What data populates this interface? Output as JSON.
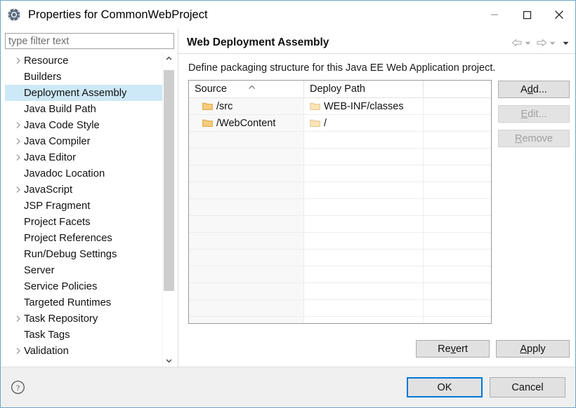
{
  "window": {
    "title": "Properties for CommonWebProject",
    "app_icon": "gear-icon",
    "minimize_label": "Minimize",
    "maximize_label": "Maximize",
    "close_label": "Close"
  },
  "filter": {
    "placeholder": "type filter text",
    "value": ""
  },
  "tree": {
    "selected": "Deployment Assembly",
    "items": [
      {
        "label": "Resource",
        "expandable": true
      },
      {
        "label": "Builders",
        "expandable": false
      },
      {
        "label": "Deployment Assembly",
        "expandable": false
      },
      {
        "label": "Java Build Path",
        "expandable": false
      },
      {
        "label": "Java Code Style",
        "expandable": true
      },
      {
        "label": "Java Compiler",
        "expandable": true
      },
      {
        "label": "Java Editor",
        "expandable": true
      },
      {
        "label": "Javadoc Location",
        "expandable": false
      },
      {
        "label": "JavaScript",
        "expandable": true
      },
      {
        "label": "JSP Fragment",
        "expandable": false
      },
      {
        "label": "Project Facets",
        "expandable": false
      },
      {
        "label": "Project References",
        "expandable": false
      },
      {
        "label": "Run/Debug Settings",
        "expandable": false
      },
      {
        "label": "Server",
        "expandable": false
      },
      {
        "label": "Service Policies",
        "expandable": false
      },
      {
        "label": "Targeted Runtimes",
        "expandable": false
      },
      {
        "label": "Task Repository",
        "expandable": true
      },
      {
        "label": "Task Tags",
        "expandable": false
      },
      {
        "label": "Validation",
        "expandable": true
      }
    ]
  },
  "page": {
    "title": "Web Deployment Assembly",
    "description": "Define packaging structure for this Java EE Web Application project.",
    "nav": {
      "back_icon": "back-arrow-icon",
      "back_menu_icon": "chevron-down-icon",
      "forward_icon": "forward-arrow-icon",
      "forward_menu_icon": "chevron-down-icon",
      "menu_icon": "chevron-down-icon"
    }
  },
  "table": {
    "sort_column": "Source",
    "sort_direction": "ascending",
    "columns": [
      "Source",
      "Deploy Path",
      ""
    ],
    "rows": [
      {
        "source": "/src",
        "deploy_path": "WEB-INF/classes",
        "icon": "folder-icon"
      },
      {
        "source": "/WebContent",
        "deploy_path": "/",
        "icon": "folder-icon"
      }
    ],
    "empty_row_count": 12
  },
  "side_buttons": [
    {
      "label": "Add...",
      "mnemonic": "d",
      "enabled": true
    },
    {
      "label": "Edit...",
      "mnemonic": "E",
      "enabled": false
    },
    {
      "label": "Remove",
      "mnemonic": "R",
      "enabled": false
    }
  ],
  "apply_buttons": [
    {
      "label": "Revert",
      "mnemonic": "v",
      "enabled": true
    },
    {
      "label": "Apply",
      "mnemonic": "A",
      "enabled": true
    }
  ],
  "footer": {
    "help_icon": "help-circle-icon",
    "ok_label": "OK",
    "cancel_label": "Cancel",
    "default_button": "OK"
  },
  "colors": {
    "selection": "#cde8f6",
    "focus_border": "#0078d7",
    "folder": "#f5cd7d",
    "dialog_bg": "#f0f0f0"
  }
}
